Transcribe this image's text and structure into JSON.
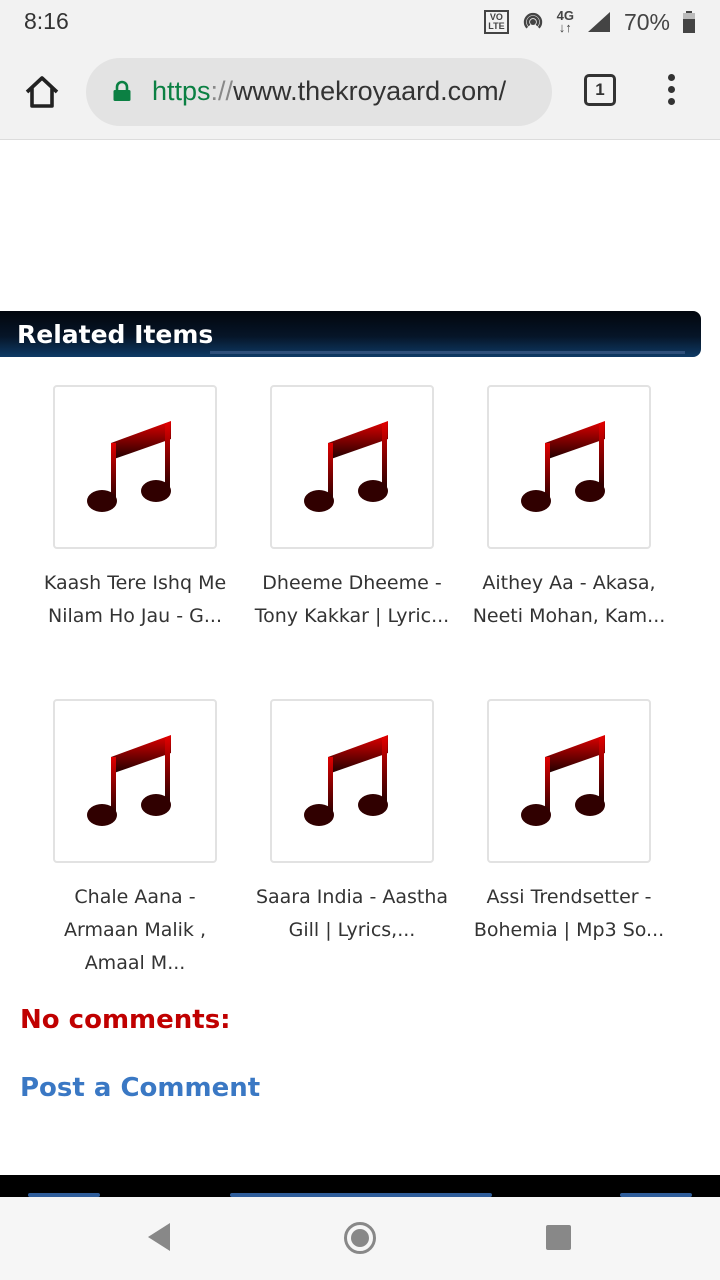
{
  "status_bar": {
    "time": "8:16",
    "volte_line1": "VO",
    "volte_line2": "LTE",
    "network": "4G",
    "battery": "70%"
  },
  "browser": {
    "url_scheme": "https",
    "url_sep": "://",
    "url_host": "www.thekroyaard.com/",
    "tab_count": "1"
  },
  "page": {
    "related_title": "Related Items",
    "items": [
      {
        "title_line1": "Kaash Tere Ishq Me",
        "title_line2": "Nilam Ho Jau - G..."
      },
      {
        "title_line1": "Dheeme Dheeme -",
        "title_line2": "Tony Kakkar | Lyric..."
      },
      {
        "title_line1": "Aithey Aa - Akasa,",
        "title_line2": "Neeti Mohan, Kam..."
      },
      {
        "title_line1": "Chale Aana -",
        "title_line2": "Armaan Malik ,",
        "title_line3": "Amaal M..."
      },
      {
        "title_line1": "Saara India - Aastha",
        "title_line2": "Gill | Lyrics,..."
      },
      {
        "title_line1": "Assi Trendsetter -",
        "title_line2": "Bohemia | Mp3 So..."
      }
    ],
    "no_comments": "No comments:",
    "post_comment": "Post a Comment"
  },
  "icons": {
    "thumbnail": "music-note-icon",
    "status": [
      "volte-icon",
      "hotspot-icon",
      "network-4g-icon",
      "signal-icon",
      "battery-icon"
    ],
    "toolbar": [
      "home-icon",
      "lock-icon",
      "tab-switcher-icon",
      "more-vert-icon"
    ],
    "nav": [
      "back-icon",
      "home-circle-icon",
      "recent-apps-icon"
    ]
  },
  "colors": {
    "url_scheme": "#0b8043",
    "no_comments": "#c00000",
    "post_comment": "#3a78c4",
    "music_note": "#c40000"
  }
}
